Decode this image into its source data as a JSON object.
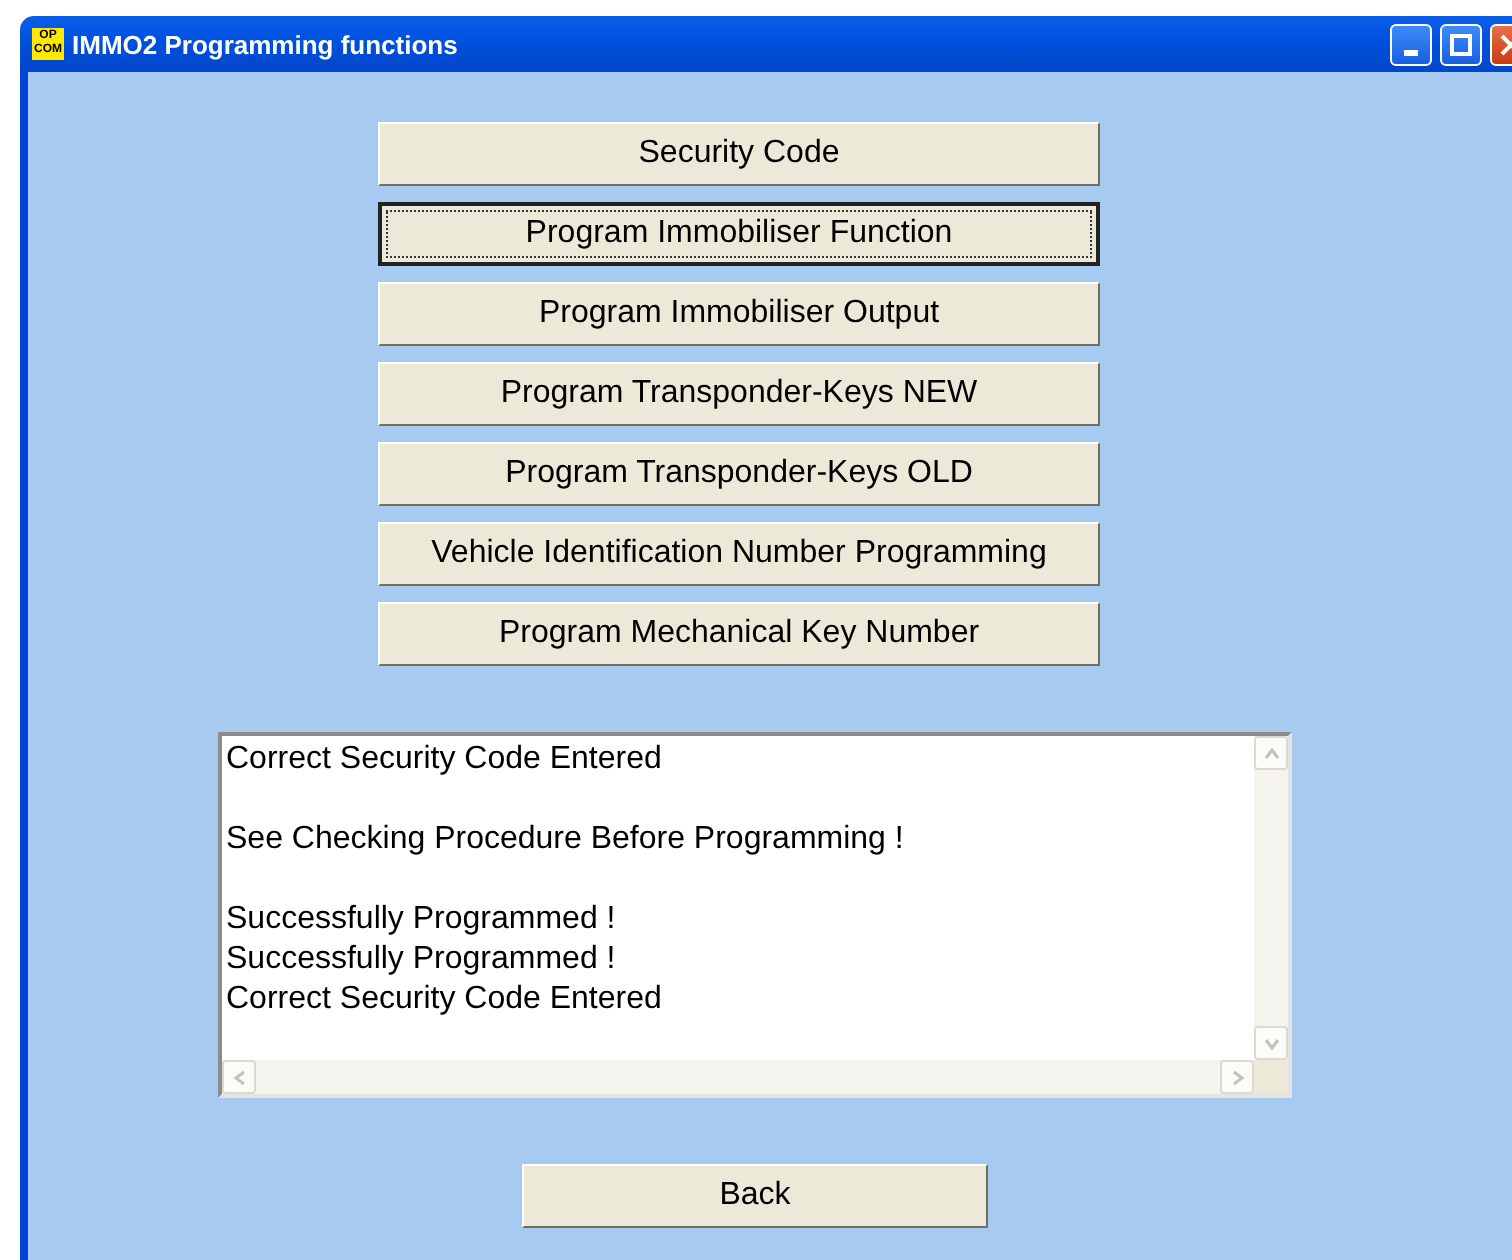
{
  "window": {
    "title": "IMMO2 Programming functions",
    "icon_text": [
      "OP",
      "COM"
    ]
  },
  "functions": [
    {
      "label": "Security Code",
      "selected": false
    },
    {
      "label": "Program Immobiliser Function",
      "selected": true
    },
    {
      "label": "Program Immobiliser Output",
      "selected": false
    },
    {
      "label": "Program Transponder-Keys NEW",
      "selected": false
    },
    {
      "label": "Program Transponder-Keys OLD",
      "selected": false
    },
    {
      "label": "Vehicle Identification Number Programming",
      "selected": false
    },
    {
      "label": "Program Mechanical Key Number",
      "selected": false
    }
  ],
  "log": {
    "paragraphs": [
      [
        "Correct Security Code Entered"
      ],
      [
        "See Checking Procedure Before Programming !"
      ],
      [
        "Successfully Programmed !",
        "Successfully Programmed !",
        "Correct Security Code Entered"
      ]
    ]
  },
  "back_button": {
    "label": "Back"
  }
}
